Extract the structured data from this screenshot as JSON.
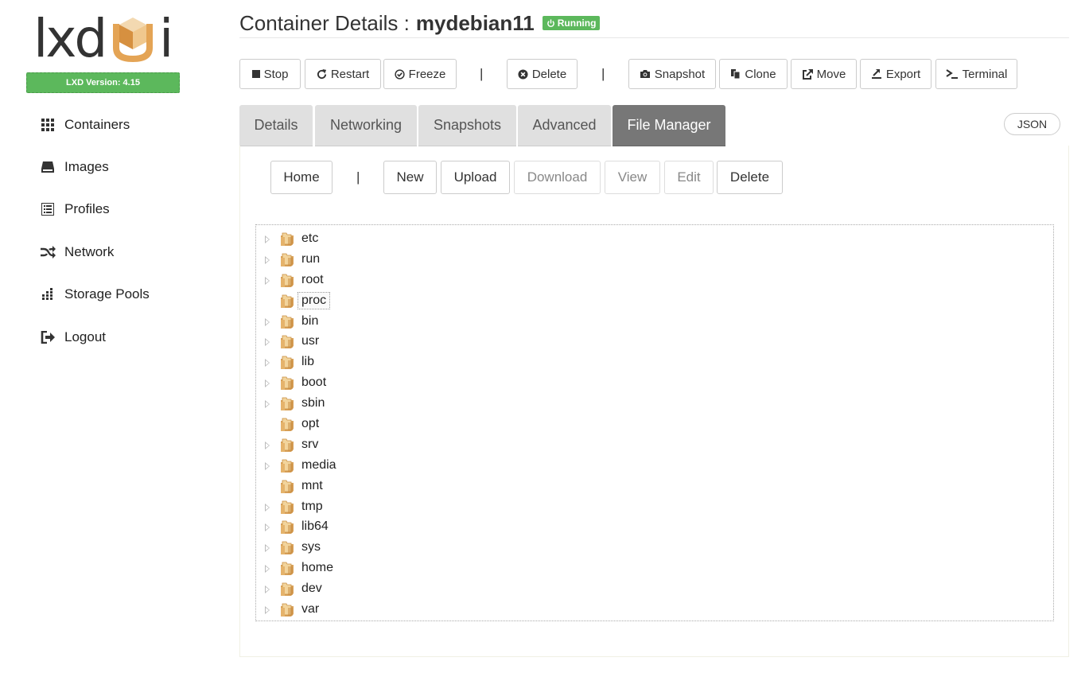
{
  "app": {
    "logo_text_left": "lxd",
    "logo_text_right": "i",
    "version": "LXD Version: 4.15",
    "accent_color": "#5cb85c"
  },
  "sidebar": {
    "items": [
      {
        "label": "Containers",
        "icon": "grid-icon"
      },
      {
        "label": "Images",
        "icon": "hdd-icon"
      },
      {
        "label": "Profiles",
        "icon": "list-icon"
      },
      {
        "label": "Network",
        "icon": "shuffle-icon"
      },
      {
        "label": "Storage Pools",
        "icon": "tasks-icon"
      },
      {
        "label": "Logout",
        "icon": "logout-icon"
      }
    ]
  },
  "header": {
    "title_label": "Container Details :",
    "container_name": "mydebian11",
    "status": "Running"
  },
  "toolbar": {
    "stop": "Stop",
    "restart": "Restart",
    "freeze": "Freeze",
    "sep": "|",
    "delete": "Delete",
    "snapshot": "Snapshot",
    "clone": "Clone",
    "move": "Move",
    "export": "Export",
    "terminal": "Terminal"
  },
  "tabs": {
    "items": [
      "Details",
      "Networking",
      "Snapshots",
      "Advanced",
      "File Manager"
    ],
    "active": "File Manager",
    "json": "JSON"
  },
  "file_manager": {
    "home": "Home",
    "sep": "|",
    "new": "New",
    "upload": "Upload",
    "download": "Download",
    "view": "View",
    "edit": "Edit",
    "delete": "Delete",
    "tree": [
      {
        "name": "etc",
        "expandable": true
      },
      {
        "name": "run",
        "expandable": true
      },
      {
        "name": "root",
        "expandable": true
      },
      {
        "name": "proc",
        "expandable": false,
        "selected": true
      },
      {
        "name": "bin",
        "expandable": true
      },
      {
        "name": "usr",
        "expandable": true
      },
      {
        "name": "lib",
        "expandable": true
      },
      {
        "name": "boot",
        "expandable": true
      },
      {
        "name": "sbin",
        "expandable": true
      },
      {
        "name": "opt",
        "expandable": false
      },
      {
        "name": "srv",
        "expandable": true
      },
      {
        "name": "media",
        "expandable": true
      },
      {
        "name": "mnt",
        "expandable": false
      },
      {
        "name": "tmp",
        "expandable": true
      },
      {
        "name": "lib64",
        "expandable": true
      },
      {
        "name": "sys",
        "expandable": true
      },
      {
        "name": "home",
        "expandable": true
      },
      {
        "name": "dev",
        "expandable": true
      },
      {
        "name": "var",
        "expandable": true
      }
    ]
  }
}
